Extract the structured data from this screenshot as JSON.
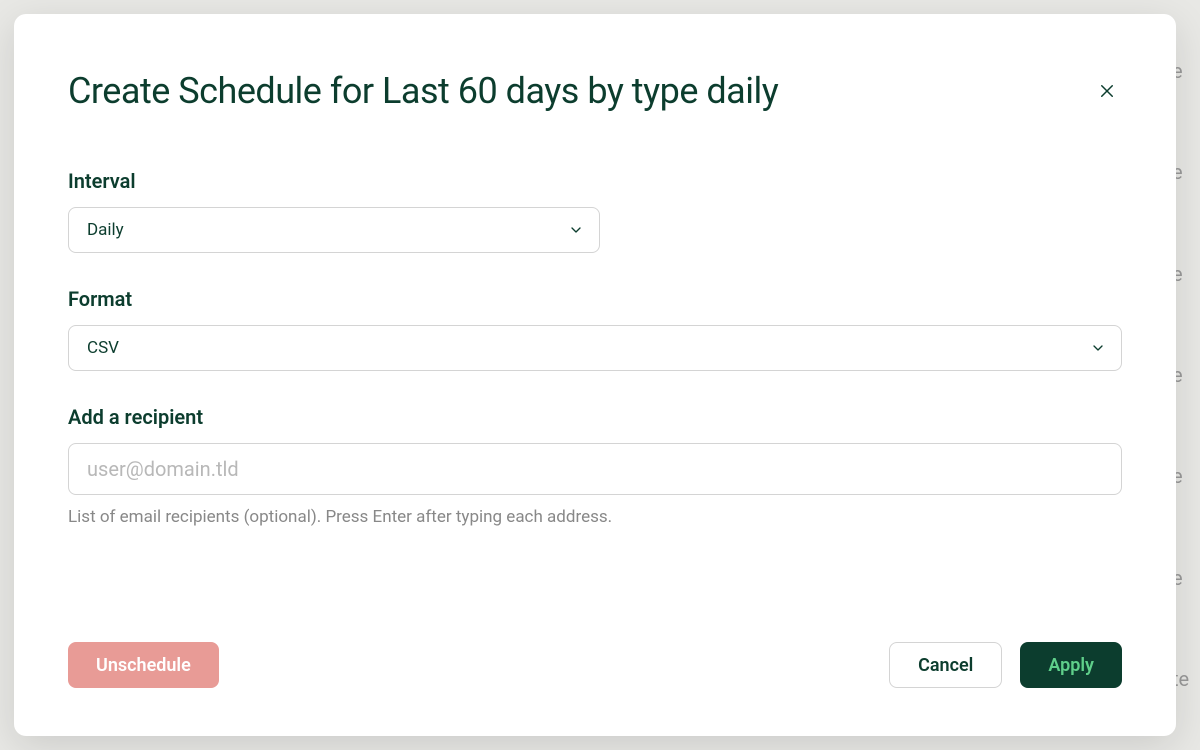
{
  "modal": {
    "title": "Create Schedule for Last 60 days by type daily",
    "fields": {
      "interval": {
        "label": "Interval",
        "value": "Daily"
      },
      "format": {
        "label": "Format",
        "value": "CSV"
      },
      "recipient": {
        "label": "Add a recipient",
        "placeholder": "user@domain.tld",
        "help": "List of email recipients (optional). Press Enter after typing each address."
      }
    },
    "buttons": {
      "unschedule": "Unschedule",
      "cancel": "Cancel",
      "apply": "Apply"
    }
  }
}
